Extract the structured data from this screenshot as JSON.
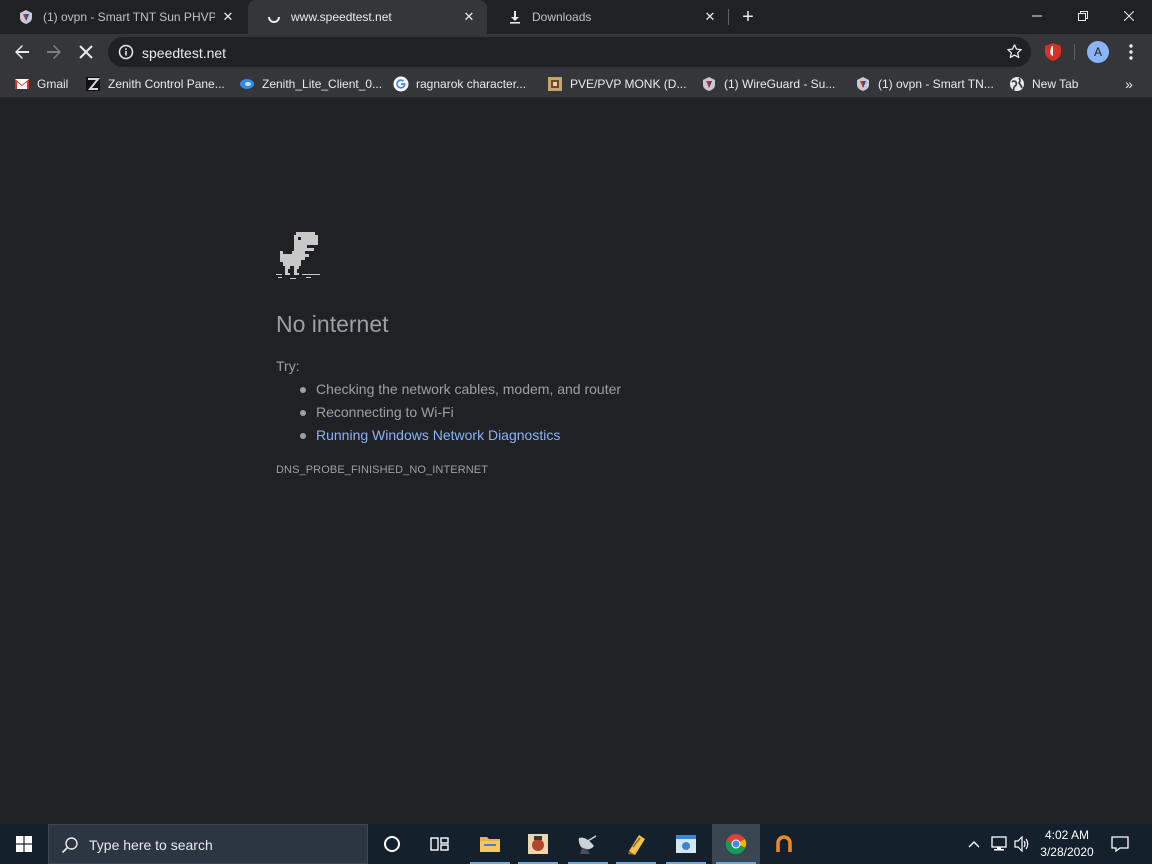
{
  "browser": {
    "tabs": [
      {
        "title": "(1) ovpn - Smart TNT Sun PHVPN",
        "icon": "vpn-logo-icon"
      },
      {
        "title": "www.speedtest.net",
        "icon": "loading-spinner-icon",
        "active": true
      },
      {
        "title": "Downloads",
        "icon": "download-icon"
      }
    ],
    "url": "speedtest.net",
    "avatar_letter": "A",
    "accent": "#8ab4f8"
  },
  "bookmarks": [
    {
      "label": "Gmail",
      "icon": "gmail-icon"
    },
    {
      "label": "Zenith Control Pane...",
      "icon": "zenith-icon"
    },
    {
      "label": "Zenith_Lite_Client_0...",
      "icon": "zenith-lite-icon"
    },
    {
      "label": "ragnarok character...",
      "icon": "google-icon"
    },
    {
      "label": "PVE/PVP MONK (D...",
      "icon": "game-icon"
    },
    {
      "label": "(1) WireGuard - Su...",
      "icon": "vpn-logo-icon"
    },
    {
      "label": "(1) ovpn - Smart TN...",
      "icon": "vpn-logo-icon"
    },
    {
      "label": "New Tab",
      "icon": "globe-icon"
    }
  ],
  "error_page": {
    "headline": "No internet",
    "try_label": "Try:",
    "suggestions": [
      "Checking the network cables, modem, and router",
      "Reconnecting to Wi-Fi",
      "Running Windows Network Diagnostics"
    ],
    "error_code": "DNS_PROBE_FINISHED_NO_INTERNET"
  },
  "taskbar": {
    "search_placeholder": "Type here to search",
    "time": "4:02 AM",
    "date": "3/28/2020"
  }
}
